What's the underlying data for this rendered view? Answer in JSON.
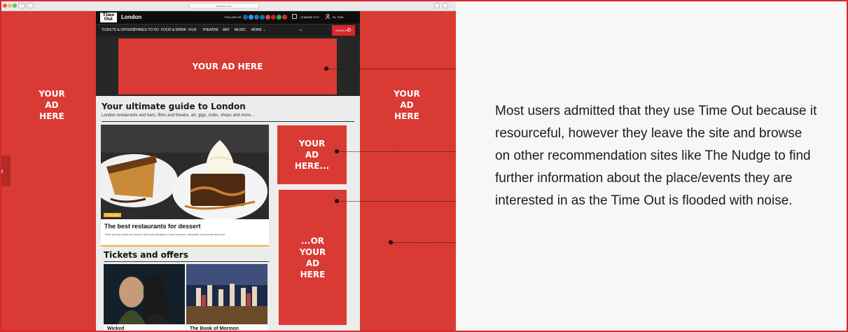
{
  "side_ads": {
    "left": [
      "YOUR",
      "AD",
      "HERE"
    ],
    "right": [
      "YOUR",
      "AD",
      "HERE"
    ]
  },
  "browser": {
    "url": "timeout.com"
  },
  "site": {
    "logo": "Time Out",
    "city": "London",
    "follow": "FOLLOW US",
    "change_city": "CHANGE CITY",
    "user": "HI, TOM",
    "nav": [
      "TICKETS & OFFERS",
      "THINGS TO DO",
      "FOOD & DRINK",
      "FILM",
      "THEATRE",
      "ART",
      "MUSIC",
      "MORE"
    ],
    "search": "SEARCH",
    "top_ad": "YOUR AD HERE",
    "guide_title": "Your ultimate guide to London",
    "guide_sub": "London restaurants and bars, films and theatre, art, gigs, clubs, shops and more...",
    "article": {
      "tag": "SPONSORED",
      "title": "The best restaurants for dessert",
      "desc": "These spots go above and beyond, with boozy affogatos, s'more macarons, chamomile crème brulée and more"
    },
    "right_ad_1": [
      "YOUR",
      "AD",
      "HERE..."
    ],
    "right_ad_2": [
      "...OR",
      "YOUR",
      "AD",
      "HERE"
    ],
    "tickets_title": "Tickets and offers",
    "tickets": [
      "Wicked",
      "The Book of Mormon"
    ]
  },
  "colors": {
    "accent": "#d93a33",
    "dark": "#0d0d0d",
    "yellow": "#f2b233"
  },
  "paragraph": "Most users admitted that they use Time Out because it resourceful, however they leave the site and browse on other recommendation sites like The Nudge to find further information about the place/events they are interested in as the Time Out is flooded with noise."
}
